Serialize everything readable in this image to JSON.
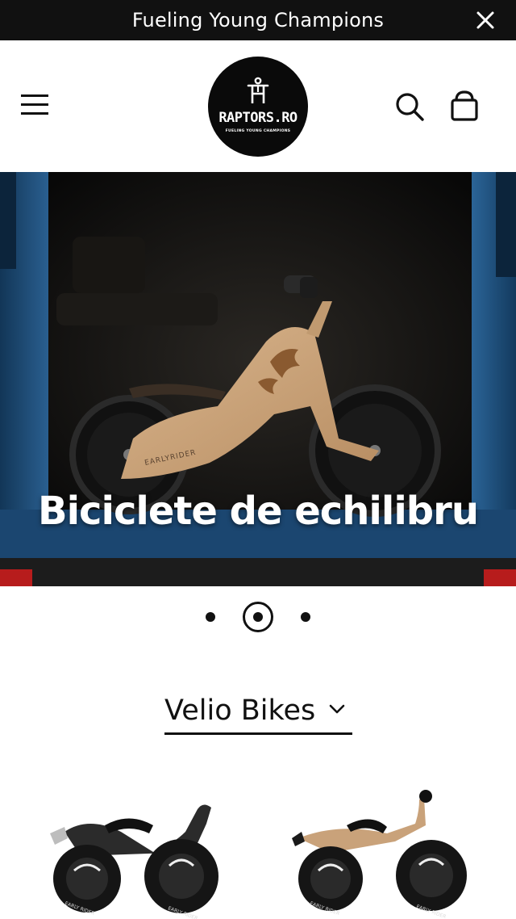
{
  "announcement": {
    "text": "Fueling Young Champions"
  },
  "header": {
    "logo_wordmark": "RAPTORS.RO",
    "logo_tagline": "FUELING YOUNG CHAMPIONS"
  },
  "hero": {
    "slide_title": "Biciclete de echilibru",
    "frame_brand": "EARLYRIDER",
    "slides_total": 3,
    "active_slide": 2
  },
  "category": {
    "selected": "Velio Bikes"
  },
  "products": [
    {
      "brand_mark": "EARLY RIDER"
    },
    {
      "brand_mark": "EARLY RIDER"
    }
  ],
  "colors": {
    "black": "#111111",
    "van_blue": "#1f4e7a",
    "wood": "#c9a27a"
  }
}
